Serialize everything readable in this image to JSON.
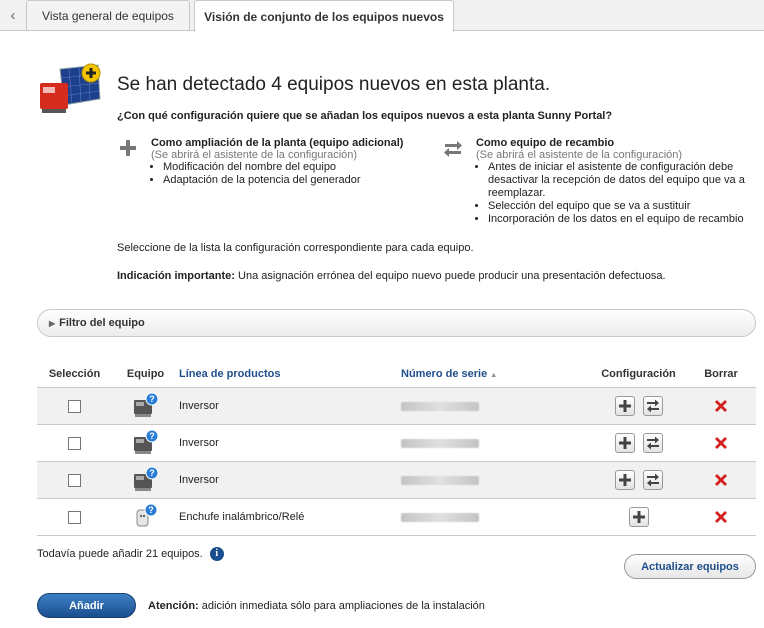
{
  "tabs": {
    "back_icon": "chevron-left-icon",
    "overview": "Vista general de equipos",
    "new_devices": "Visión de conjunto de los equipos nuevos"
  },
  "header": {
    "title": "Se han detectado 4 equipos nuevos en esta planta.",
    "question": "¿Con qué configuración quiere que se añadan los equipos nuevos a esta planta Sunny Portal?"
  },
  "option_add": {
    "icon": "plus-icon",
    "heading": "Como ampliación de la planta (equipo adicional)",
    "note": "(Se abrirá el asistente de la configuración)",
    "items": [
      "Modificación del nombre del equipo",
      "Adaptación de la potencia del generador"
    ]
  },
  "option_replace": {
    "icon": "swap-icon",
    "heading": "Como equipo de recambio",
    "note": "(Se abrirá el asistente de la configuración)",
    "items": [
      "Antes de iniciar el asistente de configuración debe desactivar la recepción de datos del equipo que va a reemplazar.",
      "Selección del equipo que se va a sustituir",
      "Incorporación de los datos en el equipo de recambio"
    ]
  },
  "instruction": "Seleccione de la lista la configuración correspondiente para cada equipo.",
  "important": {
    "label": "Indicación importante:",
    "text": " Una asignación errónea del equipo nuevo puede producir una presentación defectuosa."
  },
  "filter": {
    "label": "Filtro del equipo"
  },
  "table": {
    "headers": {
      "selection": "Selección",
      "device": "Equipo",
      "product_line": "Línea de productos",
      "serial": "Número de serie",
      "sort_icon": "sort-asc-icon",
      "config": "Configuración",
      "delete": "Borrar"
    },
    "rows": [
      {
        "checked": false,
        "icon": "inverter-icon",
        "product_line": "Inversor",
        "serial": "redacted",
        "config": [
          "add",
          "replace"
        ]
      },
      {
        "checked": false,
        "icon": "inverter-icon",
        "product_line": "Inversor",
        "serial": "redacted",
        "config": [
          "add",
          "replace"
        ]
      },
      {
        "checked": false,
        "icon": "inverter-icon",
        "product_line": "Inversor",
        "serial": "redacted",
        "config": [
          "add",
          "replace"
        ]
      },
      {
        "checked": false,
        "icon": "wireless-plug-icon",
        "product_line": "Enchufe inalámbrico/Relé",
        "serial": "redacted",
        "config": [
          "add"
        ]
      }
    ]
  },
  "remaining": "Todavía puede añadir 21 equipos.",
  "buttons": {
    "update": "Actualizar equipos",
    "add": "Añadir"
  },
  "attention": {
    "label": "Atención:",
    "text": " adición inmediata sólo para ampliaciones de la instalación"
  },
  "colors": {
    "link": "#1f4e8c",
    "add_button": "#1a4f8f",
    "delete": "#cc2222",
    "accent_yellow": "#f5c400"
  }
}
